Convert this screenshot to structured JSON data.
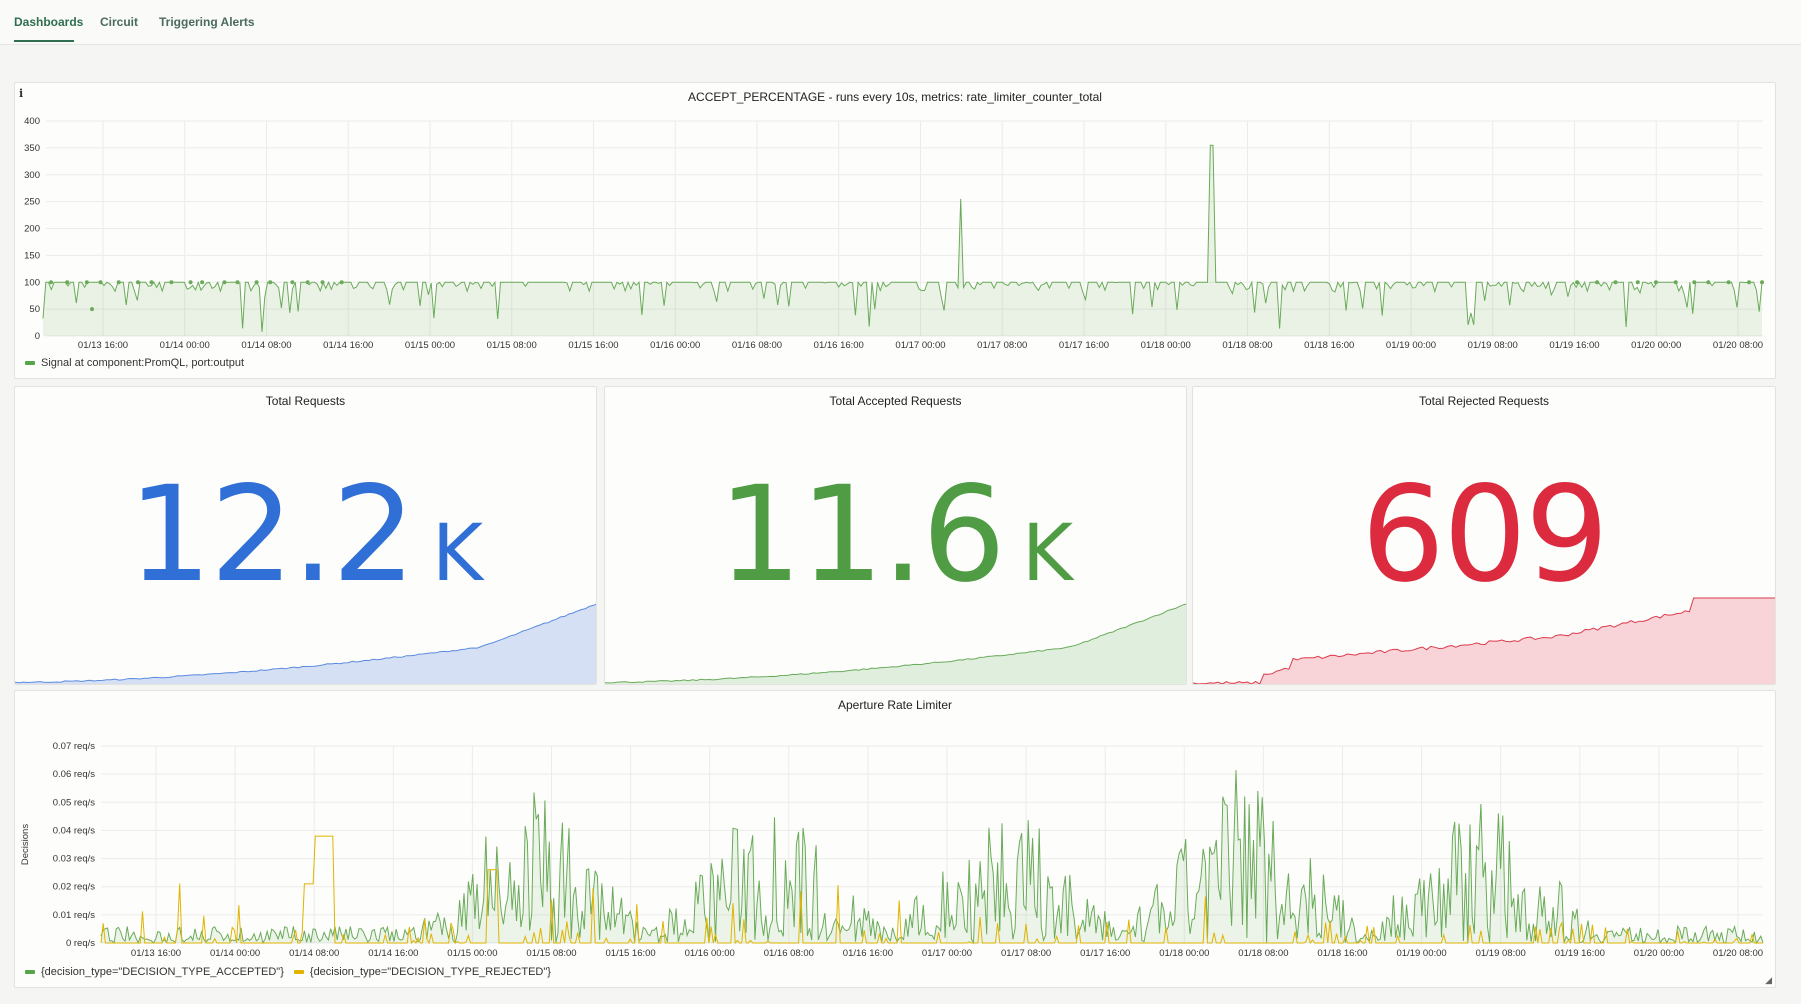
{
  "tabs": [
    {
      "label": "Dashboards",
      "active": true
    },
    {
      "label": "Circuit",
      "active": false
    },
    {
      "label": "Triggering Alerts",
      "active": false
    }
  ],
  "accept_panel": {
    "title": "ACCEPT_PERCENTAGE - runs every 10s, metrics: rate_limiter_counter_total",
    "info_icon": "i",
    "legend": "Signal at component:PromQL, port:output",
    "color": "#6aab5a"
  },
  "stats": [
    {
      "title": "Total Requests",
      "value": "12.2",
      "unit": "K",
      "color": "#2f6fd6",
      "fill": "#d5e0f5",
      "line": "#5b8be0"
    },
    {
      "title": "Total Accepted Requests",
      "value": "11.6",
      "unit": "K",
      "color": "#4f9c45",
      "fill": "#dfeedd",
      "line": "#6aab5a"
    },
    {
      "title": "Total Rejected Requests",
      "value": "609",
      "unit": "",
      "color": "#dc2a3e",
      "fill": "#f8d3d8",
      "line": "#dc3a4d"
    }
  ],
  "rate_panel": {
    "title": "Aperture Rate Limiter",
    "ylabel": "Decisions",
    "legend": [
      {
        "label": "{decision_type=\"DECISION_TYPE_ACCEPTED\"}",
        "color": "#56a64b"
      },
      {
        "label": "{decision_type=\"DECISION_TYPE_REJECTED\"}",
        "color": "#e0b400"
      }
    ]
  },
  "chart_data": [
    {
      "type": "line",
      "title": "ACCEPT_PERCENTAGE - runs every 10s, metrics: rate_limiter_counter_total",
      "ylim": [
        0,
        400
      ],
      "y_ticks": [
        "0",
        "50",
        "100",
        "150",
        "200",
        "250",
        "300",
        "350",
        "400"
      ],
      "x_ticks": [
        "01/13 16:00",
        "01/14 00:00",
        "01/14 08:00",
        "01/14 16:00",
        "01/15 00:00",
        "01/15 08:00",
        "01/15 16:00",
        "01/16 00:00",
        "01/16 08:00",
        "01/16 16:00",
        "01/17 00:00",
        "01/17 08:00",
        "01/17 16:00",
        "01/18 00:00",
        "01/18 08:00",
        "01/18 16:00",
        "01/19 00:00",
        "01/19 08:00",
        "01/19 16:00",
        "01/20 00:00",
        "01/20 08:00"
      ],
      "series": [
        {
          "name": "Signal at component:PromQL, port:output",
          "baseline": 100,
          "spikes": [
            {
              "x": "01/17 04:00",
              "y": 255
            },
            {
              "x": "01/18 04:30",
              "y": 355
            }
          ]
        }
      ],
      "grid": true,
      "legend": "bottom-left"
    },
    {
      "type": "area",
      "title": "Aperture Rate Limiter",
      "ylabel": "Decisions",
      "ylim": [
        0,
        0.07
      ],
      "y_ticks": [
        "0 req/s",
        "0.01 req/s",
        "0.02 req/s",
        "0.03 req/s",
        "0.04 req/s",
        "0.05 req/s",
        "0.06 req/s",
        "0.07 req/s"
      ],
      "x_ticks": [
        "01/13 16:00",
        "01/14 00:00",
        "01/14 08:00",
        "01/14 16:00",
        "01/15 00:00",
        "01/15 08:00",
        "01/15 16:00",
        "01/16 00:00",
        "01/16 08:00",
        "01/16 16:00",
        "01/17 00:00",
        "01/17 08:00",
        "01/17 16:00",
        "01/18 00:00",
        "01/18 08:00",
        "01/18 16:00",
        "01/19 00:00",
        "01/19 08:00",
        "01/19 16:00",
        "01/20 00:00",
        "01/20 08:00"
      ],
      "series": [
        {
          "name": "{decision_type=\"DECISION_TYPE_ACCEPTED\"}",
          "peak_max": 0.068,
          "daily_peaks": [
            0.06,
            0.058,
            0.055,
            0.068,
            0.057
          ]
        },
        {
          "name": "{decision_type=\"DECISION_TYPE_REJECTED\"}",
          "peak_max": 0.038
        }
      ],
      "grid": true,
      "legend": "bottom-left"
    }
  ]
}
